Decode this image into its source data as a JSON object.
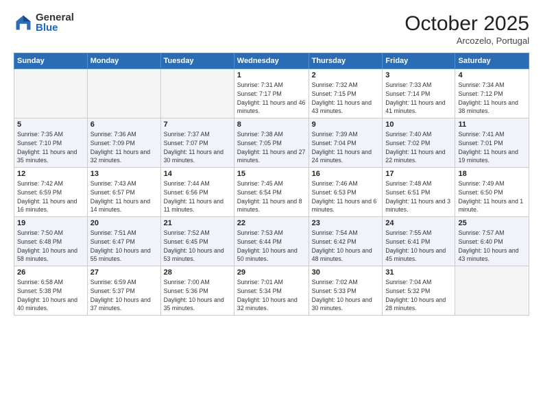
{
  "logo": {
    "general": "General",
    "blue": "Blue"
  },
  "header": {
    "month": "October 2025",
    "location": "Arcozelo, Portugal"
  },
  "weekdays": [
    "Sunday",
    "Monday",
    "Tuesday",
    "Wednesday",
    "Thursday",
    "Friday",
    "Saturday"
  ],
  "weeks": [
    [
      {
        "day": "",
        "sunrise": "",
        "sunset": "",
        "daylight": ""
      },
      {
        "day": "",
        "sunrise": "",
        "sunset": "",
        "daylight": ""
      },
      {
        "day": "",
        "sunrise": "",
        "sunset": "",
        "daylight": ""
      },
      {
        "day": "1",
        "sunrise": "Sunrise: 7:31 AM",
        "sunset": "Sunset: 7:17 PM",
        "daylight": "Daylight: 11 hours and 46 minutes."
      },
      {
        "day": "2",
        "sunrise": "Sunrise: 7:32 AM",
        "sunset": "Sunset: 7:15 PM",
        "daylight": "Daylight: 11 hours and 43 minutes."
      },
      {
        "day": "3",
        "sunrise": "Sunrise: 7:33 AM",
        "sunset": "Sunset: 7:14 PM",
        "daylight": "Daylight: 11 hours and 41 minutes."
      },
      {
        "day": "4",
        "sunrise": "Sunrise: 7:34 AM",
        "sunset": "Sunset: 7:12 PM",
        "daylight": "Daylight: 11 hours and 38 minutes."
      }
    ],
    [
      {
        "day": "5",
        "sunrise": "Sunrise: 7:35 AM",
        "sunset": "Sunset: 7:10 PM",
        "daylight": "Daylight: 11 hours and 35 minutes."
      },
      {
        "day": "6",
        "sunrise": "Sunrise: 7:36 AM",
        "sunset": "Sunset: 7:09 PM",
        "daylight": "Daylight: 11 hours and 32 minutes."
      },
      {
        "day": "7",
        "sunrise": "Sunrise: 7:37 AM",
        "sunset": "Sunset: 7:07 PM",
        "daylight": "Daylight: 11 hours and 30 minutes."
      },
      {
        "day": "8",
        "sunrise": "Sunrise: 7:38 AM",
        "sunset": "Sunset: 7:05 PM",
        "daylight": "Daylight: 11 hours and 27 minutes."
      },
      {
        "day": "9",
        "sunrise": "Sunrise: 7:39 AM",
        "sunset": "Sunset: 7:04 PM",
        "daylight": "Daylight: 11 hours and 24 minutes."
      },
      {
        "day": "10",
        "sunrise": "Sunrise: 7:40 AM",
        "sunset": "Sunset: 7:02 PM",
        "daylight": "Daylight: 11 hours and 22 minutes."
      },
      {
        "day": "11",
        "sunrise": "Sunrise: 7:41 AM",
        "sunset": "Sunset: 7:01 PM",
        "daylight": "Daylight: 11 hours and 19 minutes."
      }
    ],
    [
      {
        "day": "12",
        "sunrise": "Sunrise: 7:42 AM",
        "sunset": "Sunset: 6:59 PM",
        "daylight": "Daylight: 11 hours and 16 minutes."
      },
      {
        "day": "13",
        "sunrise": "Sunrise: 7:43 AM",
        "sunset": "Sunset: 6:57 PM",
        "daylight": "Daylight: 11 hours and 14 minutes."
      },
      {
        "day": "14",
        "sunrise": "Sunrise: 7:44 AM",
        "sunset": "Sunset: 6:56 PM",
        "daylight": "Daylight: 11 hours and 11 minutes."
      },
      {
        "day": "15",
        "sunrise": "Sunrise: 7:45 AM",
        "sunset": "Sunset: 6:54 PM",
        "daylight": "Daylight: 11 hours and 8 minutes."
      },
      {
        "day": "16",
        "sunrise": "Sunrise: 7:46 AM",
        "sunset": "Sunset: 6:53 PM",
        "daylight": "Daylight: 11 hours and 6 minutes."
      },
      {
        "day": "17",
        "sunrise": "Sunrise: 7:48 AM",
        "sunset": "Sunset: 6:51 PM",
        "daylight": "Daylight: 11 hours and 3 minutes."
      },
      {
        "day": "18",
        "sunrise": "Sunrise: 7:49 AM",
        "sunset": "Sunset: 6:50 PM",
        "daylight": "Daylight: 11 hours and 1 minute."
      }
    ],
    [
      {
        "day": "19",
        "sunrise": "Sunrise: 7:50 AM",
        "sunset": "Sunset: 6:48 PM",
        "daylight": "Daylight: 10 hours and 58 minutes."
      },
      {
        "day": "20",
        "sunrise": "Sunrise: 7:51 AM",
        "sunset": "Sunset: 6:47 PM",
        "daylight": "Daylight: 10 hours and 55 minutes."
      },
      {
        "day": "21",
        "sunrise": "Sunrise: 7:52 AM",
        "sunset": "Sunset: 6:45 PM",
        "daylight": "Daylight: 10 hours and 53 minutes."
      },
      {
        "day": "22",
        "sunrise": "Sunrise: 7:53 AM",
        "sunset": "Sunset: 6:44 PM",
        "daylight": "Daylight: 10 hours and 50 minutes."
      },
      {
        "day": "23",
        "sunrise": "Sunrise: 7:54 AM",
        "sunset": "Sunset: 6:42 PM",
        "daylight": "Daylight: 10 hours and 48 minutes."
      },
      {
        "day": "24",
        "sunrise": "Sunrise: 7:55 AM",
        "sunset": "Sunset: 6:41 PM",
        "daylight": "Daylight: 10 hours and 45 minutes."
      },
      {
        "day": "25",
        "sunrise": "Sunrise: 7:57 AM",
        "sunset": "Sunset: 6:40 PM",
        "daylight": "Daylight: 10 hours and 43 minutes."
      }
    ],
    [
      {
        "day": "26",
        "sunrise": "Sunrise: 6:58 AM",
        "sunset": "Sunset: 5:38 PM",
        "daylight": "Daylight: 10 hours and 40 minutes."
      },
      {
        "day": "27",
        "sunrise": "Sunrise: 6:59 AM",
        "sunset": "Sunset: 5:37 PM",
        "daylight": "Daylight: 10 hours and 37 minutes."
      },
      {
        "day": "28",
        "sunrise": "Sunrise: 7:00 AM",
        "sunset": "Sunset: 5:36 PM",
        "daylight": "Daylight: 10 hours and 35 minutes."
      },
      {
        "day": "29",
        "sunrise": "Sunrise: 7:01 AM",
        "sunset": "Sunset: 5:34 PM",
        "daylight": "Daylight: 10 hours and 32 minutes."
      },
      {
        "day": "30",
        "sunrise": "Sunrise: 7:02 AM",
        "sunset": "Sunset: 5:33 PM",
        "daylight": "Daylight: 10 hours and 30 minutes."
      },
      {
        "day": "31",
        "sunrise": "Sunrise: 7:04 AM",
        "sunset": "Sunset: 5:32 PM",
        "daylight": "Daylight: 10 hours and 28 minutes."
      },
      {
        "day": "",
        "sunrise": "",
        "sunset": "",
        "daylight": ""
      }
    ]
  ]
}
